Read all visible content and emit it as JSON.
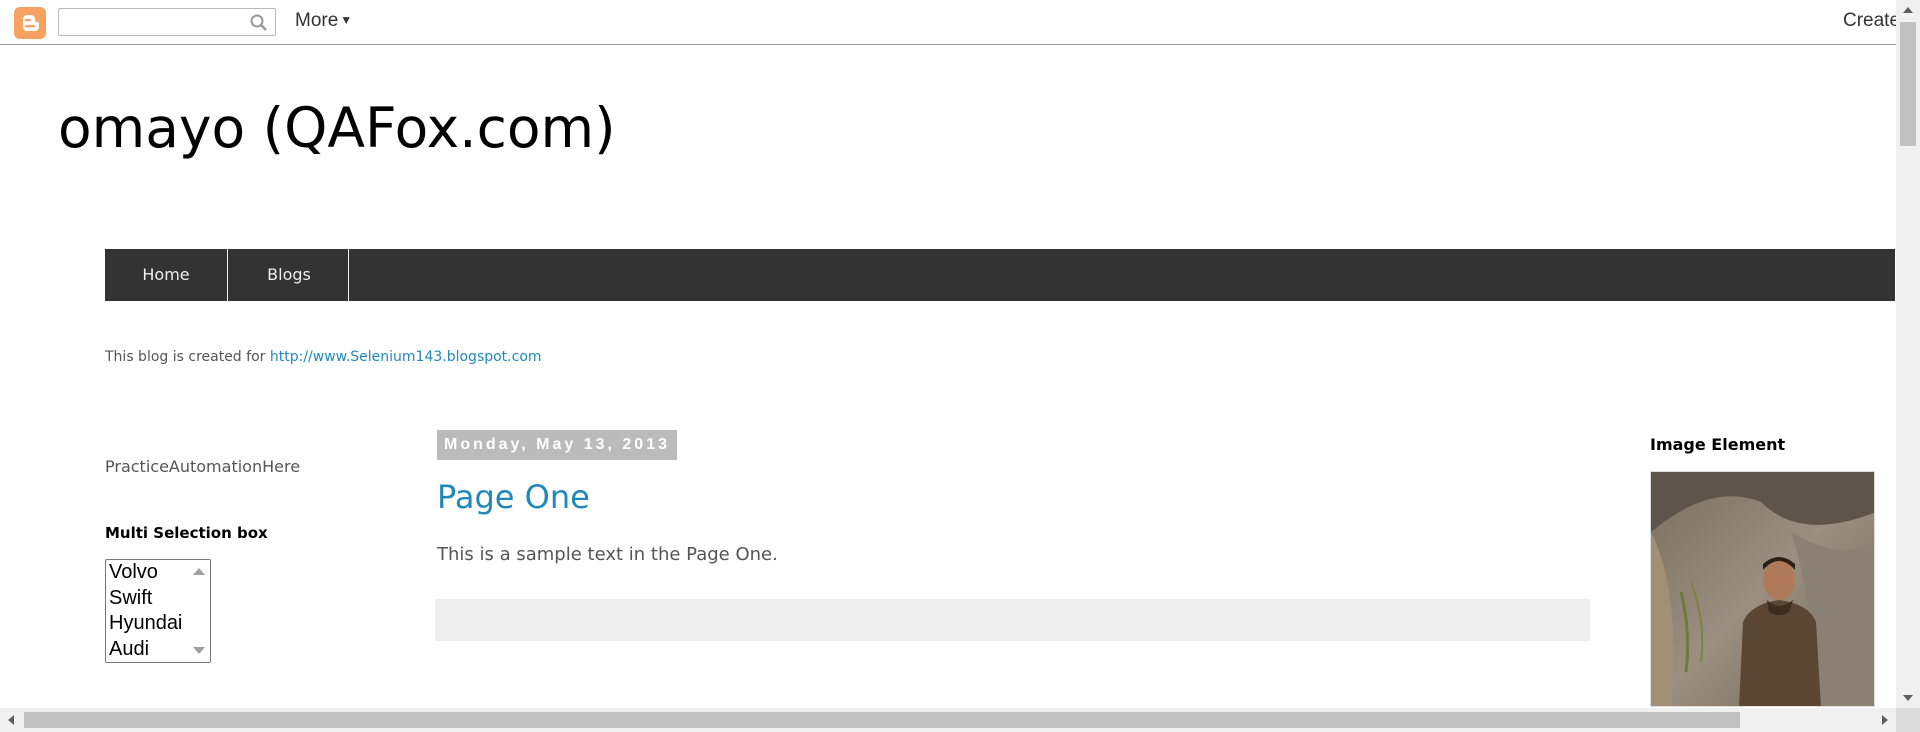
{
  "navbar": {
    "search_placeholder": "",
    "more_label": "More",
    "create_label": "Create"
  },
  "blog": {
    "title": "omayo (QAFox.com)",
    "description_prefix": "This blog is created for ",
    "description_link": "http://www.Selenium143.blogspot.com"
  },
  "tabs": [
    {
      "label": "Home"
    },
    {
      "label": "Blogs"
    }
  ],
  "left_sidebar": {
    "practice_text": "PracticeAutomationHere",
    "multi_select_title": "Multi Selection box",
    "options": [
      "Volvo",
      "Swift",
      "Hyundai",
      "Audi"
    ]
  },
  "post": {
    "date": "Monday, May 13, 2013",
    "title": "Page One",
    "body": "This is a sample text in the Page One."
  },
  "right_sidebar": {
    "image_title": "Image Element"
  },
  "colors": {
    "tab_bar": "#333333",
    "link": "#2288bb",
    "date_header": "#bbbbbb",
    "blogger_orange": "#f7a261"
  }
}
